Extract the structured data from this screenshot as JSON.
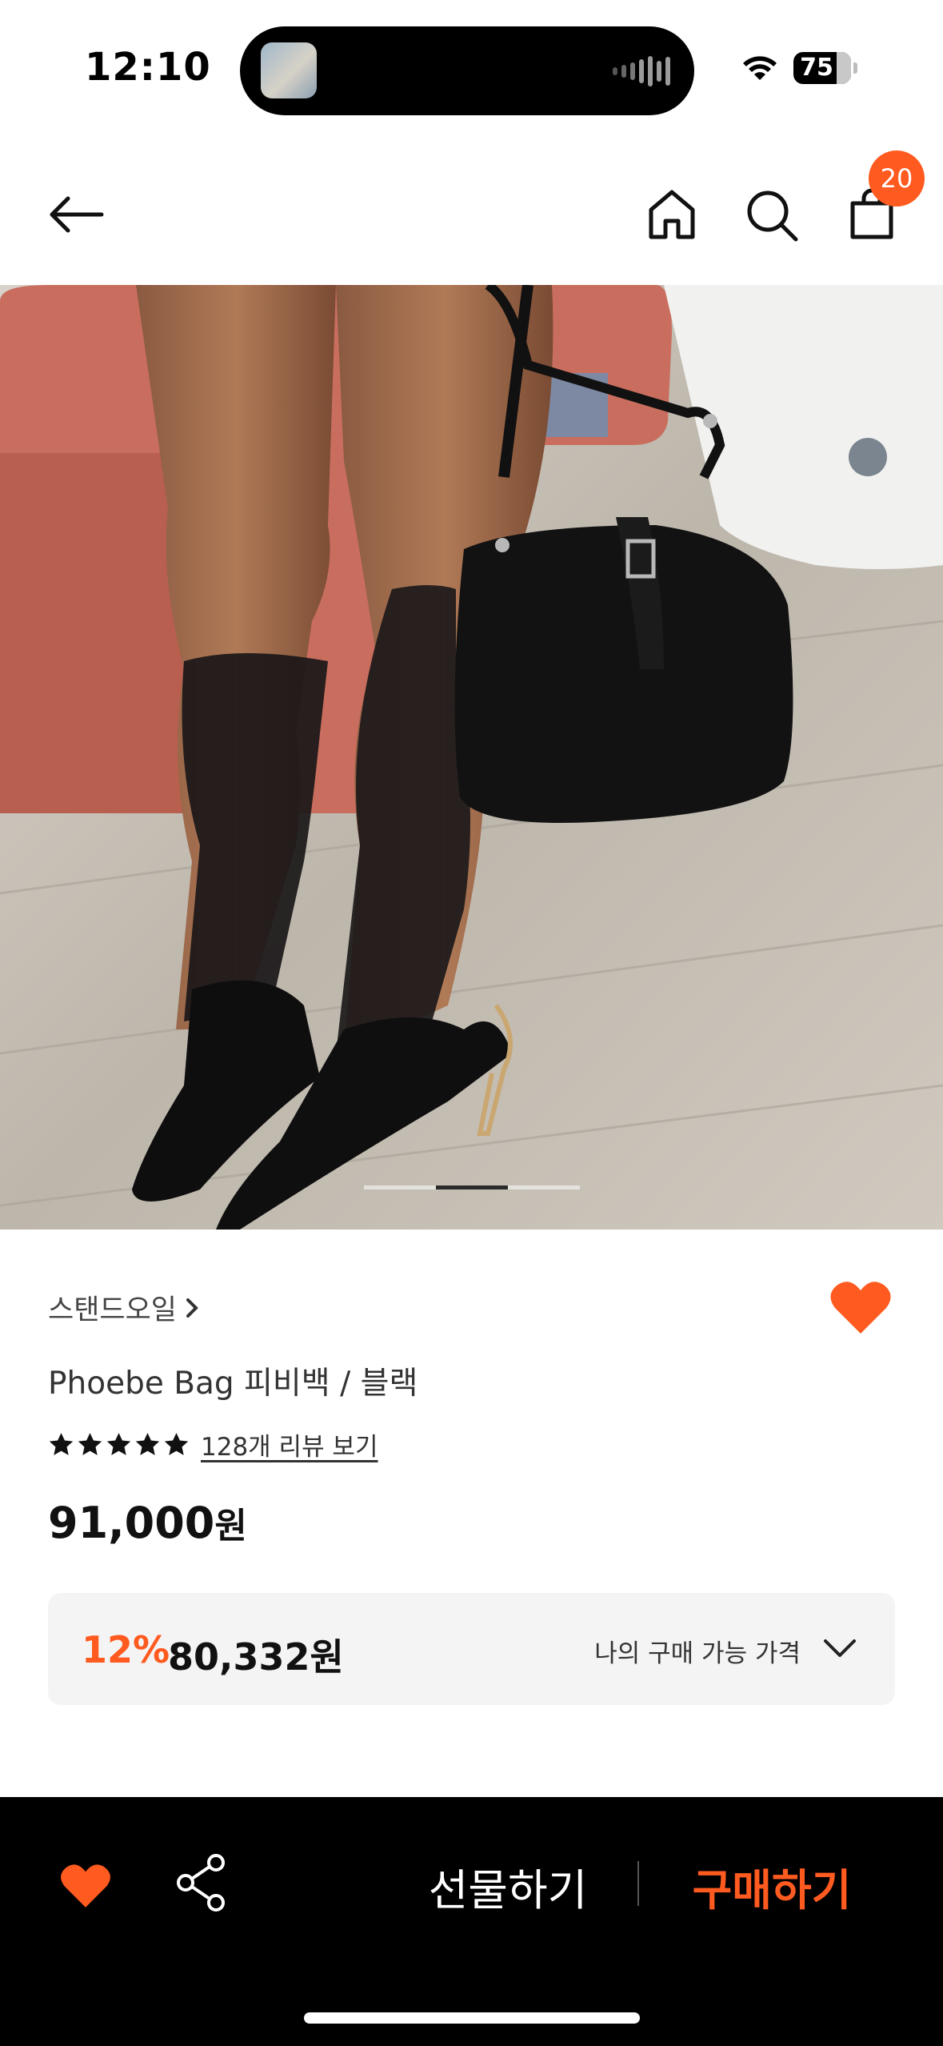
{
  "status_bar": {
    "time": "12:10",
    "battery": "75",
    "icons": [
      "wifi-icon",
      "battery-icon"
    ]
  },
  "header": {
    "icons": [
      "back-arrow-icon",
      "home-icon",
      "search-icon",
      "shopping-bag-icon"
    ],
    "cart_badge": "20"
  },
  "hero": {
    "image_count": 3,
    "active_index": 1
  },
  "product": {
    "brand": "스탠드오일",
    "title": "Phoebe Bag 피비백 / 블랙",
    "rating_stars": 5,
    "review_link": "128개 리뷰 보기",
    "price_number": "91,000",
    "price_unit": "원",
    "discount_pct": "12%",
    "discount_price": "80,332원",
    "my_price_label": "나의 구매 가능 가격"
  },
  "bottom_bar": {
    "gift_label": "선물하기",
    "buy_label": "구매하기"
  },
  "colors": {
    "accent": "#ff5a1f",
    "bottom_bar_bg": "#000000",
    "price_box_bg": "#f4f4f4"
  }
}
